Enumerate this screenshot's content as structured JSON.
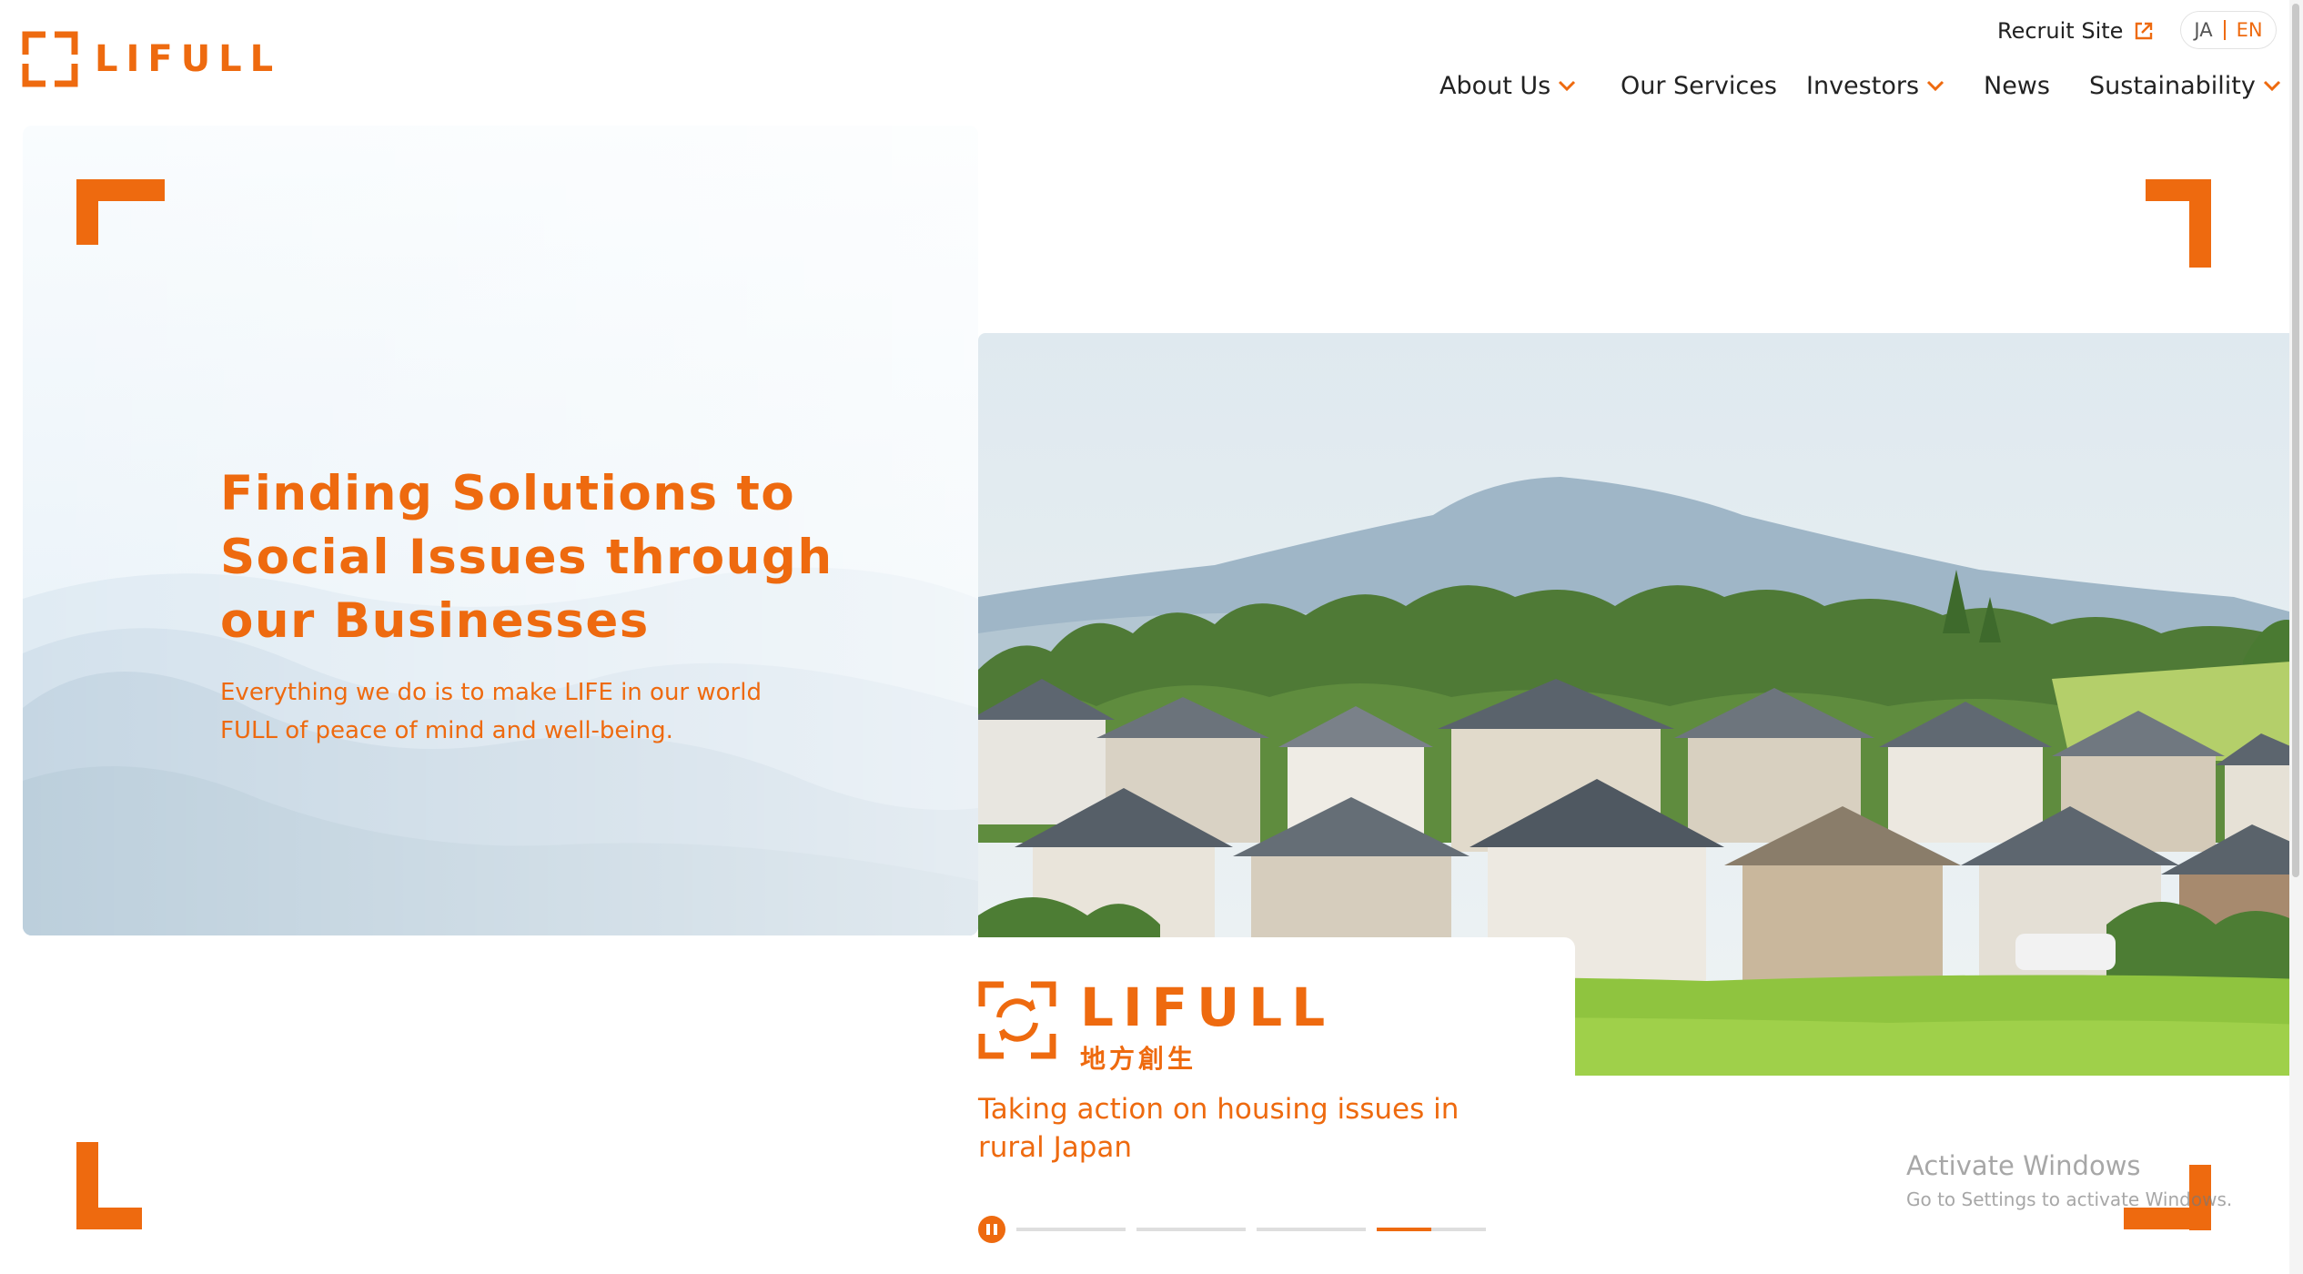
{
  "brand": {
    "logo_text": "LIFULL",
    "accent_color": "#ee6a0f"
  },
  "header": {
    "recruit_label": "Recruit Site",
    "recruit_icon": "external-link-icon",
    "lang": {
      "ja": "JA",
      "en": "EN",
      "selected": "EN"
    }
  },
  "nav": [
    {
      "label": "About Us",
      "has_dropdown": true
    },
    {
      "label": "Our Services",
      "has_dropdown": false
    },
    {
      "label": "Investors",
      "has_dropdown": true
    },
    {
      "label": "News",
      "has_dropdown": false
    },
    {
      "label": "Sustainability",
      "has_dropdown": true
    }
  ],
  "hero": {
    "title_lines": [
      "Finding Solutions to",
      "Social Issues through",
      "our Businesses"
    ],
    "subtitle_lines": [
      "Everything we do is to make LIFE in our world",
      "FULL of peace of mind and well-being."
    ]
  },
  "slide": {
    "logo_name": "LIFULL",
    "logo_jp": "地方創生",
    "caption_lines": [
      "Taking action on housing issues in",
      "rural Japan"
    ],
    "count": 4,
    "active_index": 3,
    "active_progress": 0.5
  },
  "overlay": {
    "activate_title": "Activate Windows",
    "activate_sub": "Go to Settings to activate Windows."
  }
}
